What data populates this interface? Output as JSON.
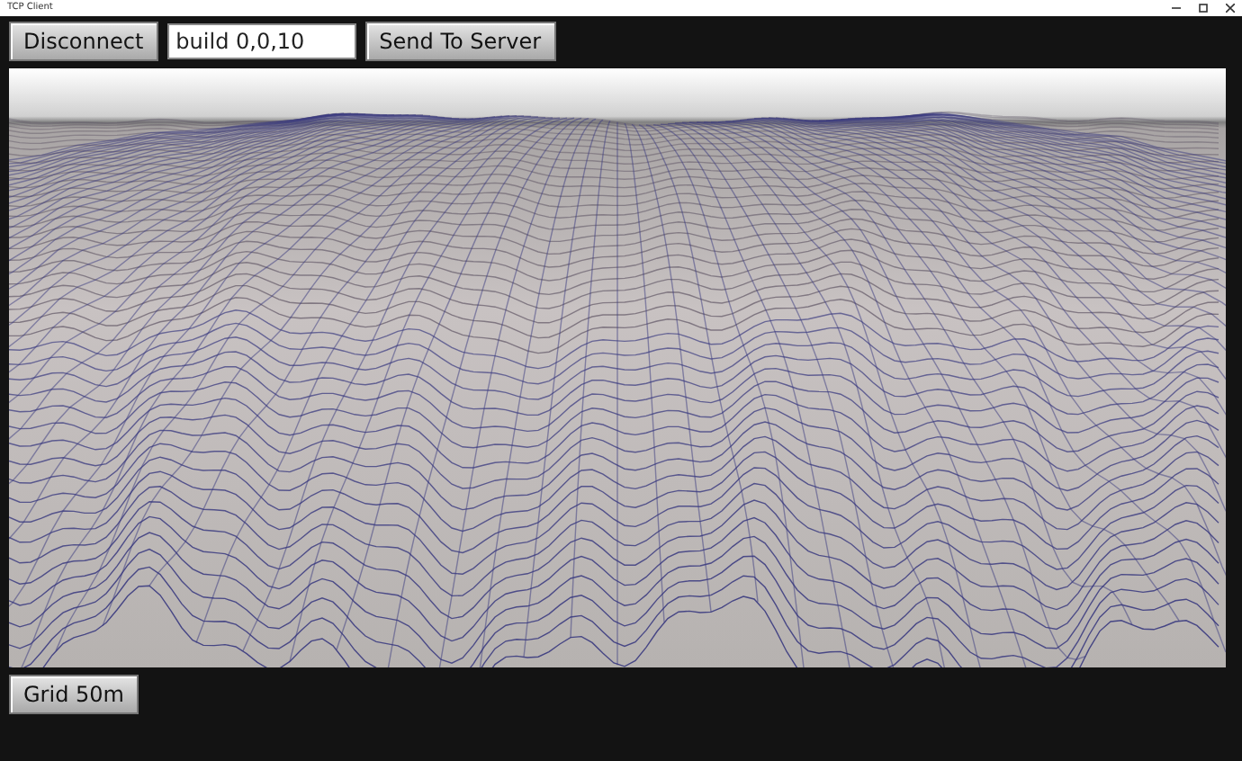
{
  "window": {
    "title": "TCP Client"
  },
  "toolbar": {
    "disconnect_button": "Disconnect",
    "command_field": {
      "value": "build 0,0,10"
    },
    "send_button": "Send To Server"
  },
  "footer": {
    "grid_button": "Grid 50m"
  }
}
